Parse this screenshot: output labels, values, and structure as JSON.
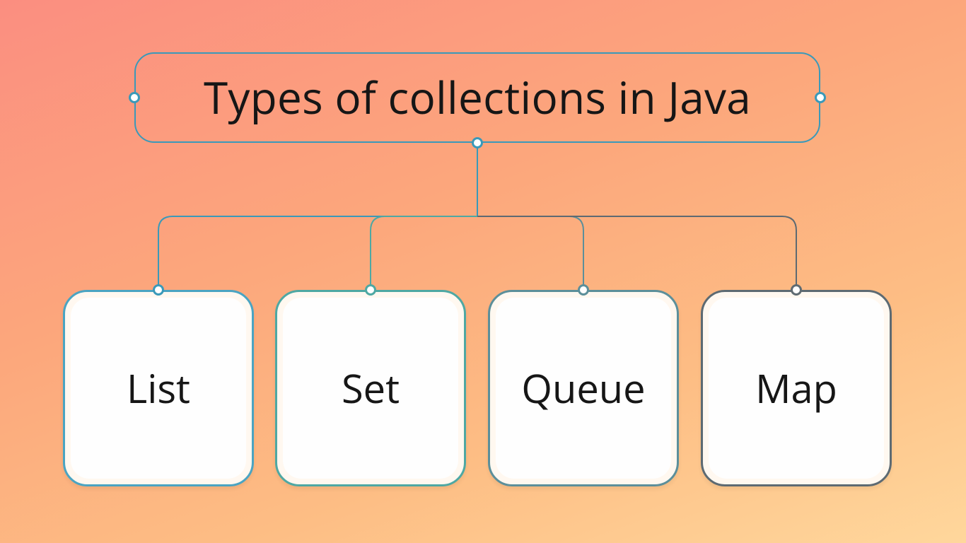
{
  "title": "Types of collections in Java",
  "nodes": [
    {
      "label": "List"
    },
    {
      "label": "Set"
    },
    {
      "label": "Queue"
    },
    {
      "label": "Map"
    }
  ]
}
